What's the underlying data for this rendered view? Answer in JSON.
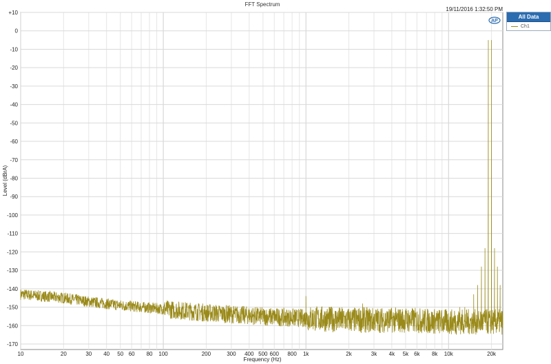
{
  "timestamp": "19/11/2016 1:32:50 PM",
  "legend": {
    "header": "All Data",
    "series_name": "Ch1",
    "series_color": "#9a8a1a"
  },
  "logo_icon": "ap-logo-icon",
  "chart_data": {
    "type": "line",
    "title": "FFT Spectrum",
    "xlabel": "Frequency (Hz)",
    "ylabel": "Level (dBrA)",
    "x_scale": "log",
    "xlim": [
      10,
      24000
    ],
    "ylim": [
      -173,
      10
    ],
    "grid": true,
    "legend_position": "top-right",
    "x_ticks": [
      10,
      20,
      30,
      40,
      50,
      60,
      80,
      100,
      200,
      300,
      400,
      500,
      600,
      800,
      1000,
      2000,
      3000,
      4000,
      5000,
      6000,
      8000,
      10000,
      20000
    ],
    "x_tick_labels": [
      "10",
      "20",
      "30",
      "40",
      "50",
      "60",
      "80",
      "100",
      "200",
      "300",
      "400",
      "500",
      "600",
      "800",
      "1k",
      "2k",
      "3k",
      "4k",
      "5k",
      "6k",
      "8k",
      "10k",
      "20k"
    ],
    "y_ticks": [
      10,
      0,
      -10,
      -20,
      -30,
      -40,
      -50,
      -60,
      -70,
      -80,
      -90,
      -100,
      -110,
      -120,
      -130,
      -140,
      -150,
      -160,
      -170
    ],
    "y_tick_labels": [
      "+10",
      "0",
      "-10",
      "-20",
      "-30",
      "-40",
      "-50",
      "-60",
      "-70",
      "-80",
      "-90",
      "-100",
      "-110",
      "-120",
      "-130",
      "-140",
      "-150",
      "-160",
      "-170"
    ],
    "series": [
      {
        "name": "Ch1",
        "color": "#9a8a1a",
        "noise_floor": [
          [
            10,
            -143
          ],
          [
            20,
            -145
          ],
          [
            30,
            -147
          ],
          [
            50,
            -149
          ],
          [
            100,
            -151
          ],
          [
            200,
            -153
          ],
          [
            500,
            -155
          ],
          [
            1000,
            -156
          ],
          [
            2000,
            -157
          ],
          [
            5000,
            -157
          ],
          [
            10000,
            -158
          ],
          [
            24000,
            -158
          ]
        ],
        "peaks": [
          [
            1000,
            -144
          ],
          [
            2500,
            -148
          ],
          [
            11000,
            -152
          ],
          [
            12000,
            -150
          ],
          [
            13000,
            -150
          ],
          [
            15000,
            -143
          ],
          [
            16000,
            -138
          ],
          [
            17000,
            -128
          ],
          [
            18000,
            -118
          ],
          [
            19000,
            -5
          ],
          [
            20000,
            -5
          ],
          [
            21000,
            -118
          ],
          [
            22000,
            -128
          ],
          [
            23000,
            -138
          ]
        ]
      }
    ]
  }
}
